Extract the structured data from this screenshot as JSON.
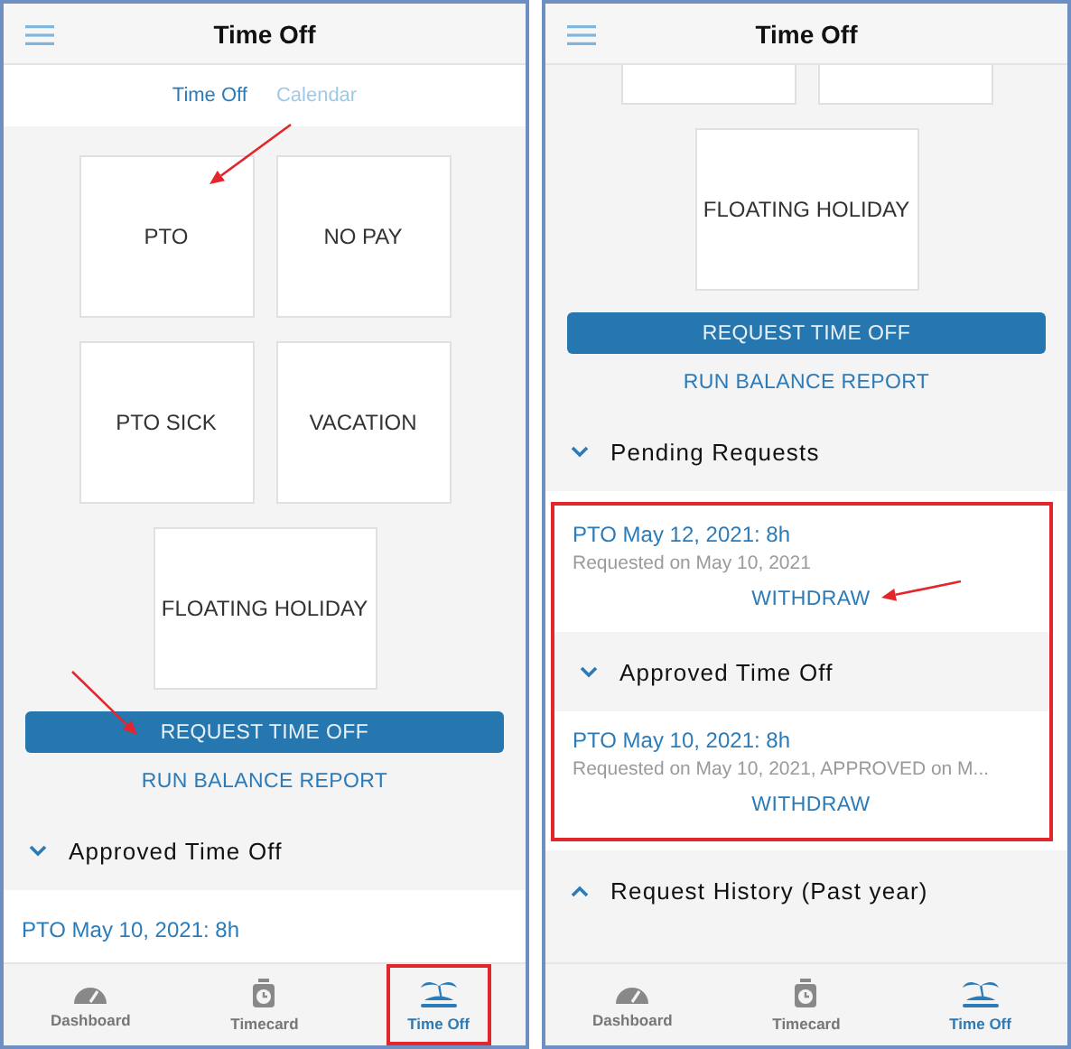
{
  "screens": [
    {
      "title": "Time Off",
      "segments": [
        {
          "label": "Time Off",
          "selected": true
        },
        {
          "label": "Calendar",
          "selected": false
        }
      ],
      "tiles": [
        {
          "kind": "full",
          "label": "PTO",
          "pointed": true
        },
        {
          "kind": "full",
          "label": "NO PAY"
        },
        {
          "kind": "full",
          "label": "PTO SICK"
        },
        {
          "kind": "full",
          "label": "VACATION"
        },
        {
          "kind": "full",
          "label": "FLOATING HOLIDAY"
        }
      ],
      "request_button": {
        "label": "REQUEST TIME OFF",
        "pointed": true
      },
      "report_link": "RUN BALANCE REPORT",
      "sections": [
        {
          "title": "Approved Time Off",
          "expanded": true,
          "framed": false,
          "entries": [
            {
              "title": "PTO May 10, 2021: 8h"
            }
          ]
        }
      ],
      "tab_bar": [
        {
          "label": "Dashboard",
          "selected": false,
          "highlighted": false
        },
        {
          "label": "Timecard",
          "selected": false,
          "highlighted": false
        },
        {
          "label": "Time Off",
          "selected": true,
          "highlighted": true
        }
      ]
    },
    {
      "title": "Time Off",
      "tiles": [
        {
          "kind": "partial"
        },
        {
          "kind": "partial"
        },
        {
          "kind": "full",
          "label": "FLOATING HOLIDAY"
        }
      ],
      "request_button": {
        "label": "REQUEST TIME OFF"
      },
      "report_link": "RUN BALANCE REPORT",
      "sections": [
        {
          "title": "Pending Requests",
          "expanded": true,
          "framed": true,
          "entries": [
            {
              "title": "PTO May 12, 2021: 8h",
              "detail": "Requested on May 10, 2021",
              "action": "WITHDRAW",
              "pointed": true
            }
          ]
        },
        {
          "title": "Approved Time Off",
          "expanded": true,
          "framed": true,
          "entries": [
            {
              "title": "PTO May 10, 2021: 8h",
              "detail": "Requested on May 10, 2021, APPROVED on M...",
              "action": "WITHDRAW"
            }
          ]
        },
        {
          "title": "Request History (Past year)",
          "expanded": false,
          "framed": false
        }
      ],
      "tab_bar": [
        {
          "label": "Dashboard",
          "selected": false,
          "highlighted": false
        },
        {
          "label": "Timecard",
          "selected": false,
          "highlighted": false
        },
        {
          "label": "Time Off",
          "selected": true,
          "highlighted": false
        }
      ]
    }
  ]
}
